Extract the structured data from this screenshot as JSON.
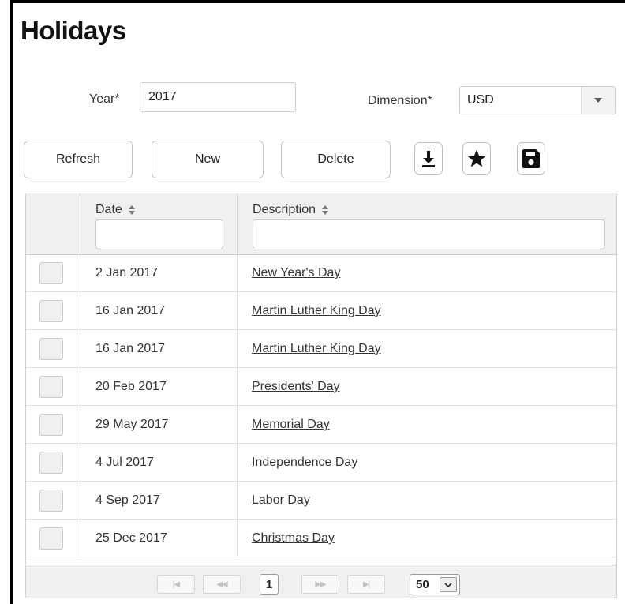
{
  "page": {
    "title": "Holidays"
  },
  "filters": {
    "year_label": "Year*",
    "year_value": "2017",
    "dimension_label": "Dimension*",
    "dimension_value": "USD"
  },
  "toolbar": {
    "refresh_label": "Refresh",
    "new_label": "New",
    "delete_label": "Delete",
    "icons": [
      "download-icon",
      "star-icon",
      "save-icon"
    ]
  },
  "table": {
    "columns": [
      {
        "label": "Date",
        "sortable": true
      },
      {
        "label": "Description",
        "sortable": true
      }
    ],
    "rows": [
      {
        "date": "2 Jan 2017",
        "description": "New Year's Day"
      },
      {
        "date": "16 Jan 2017",
        "description": "Martin Luther King Day"
      },
      {
        "date": "16 Jan 2017",
        "description": "Martin Luther King Day"
      },
      {
        "date": "20 Feb 2017",
        "description": "Presidents' Day"
      },
      {
        "date": "29 May 2017",
        "description": "Memorial Day"
      },
      {
        "date": "4 Jul 2017",
        "description": "Independence Day"
      },
      {
        "date": "4 Sep 2017",
        "description": "Labor Day"
      },
      {
        "date": "25 Dec 2017",
        "description": "Christmas Day"
      }
    ]
  },
  "pager": {
    "first_label": "|◀",
    "prev_label": "◀◀",
    "current_page": "1",
    "next_label": "▶▶",
    "last_label": "▶|",
    "page_size": "50"
  }
}
